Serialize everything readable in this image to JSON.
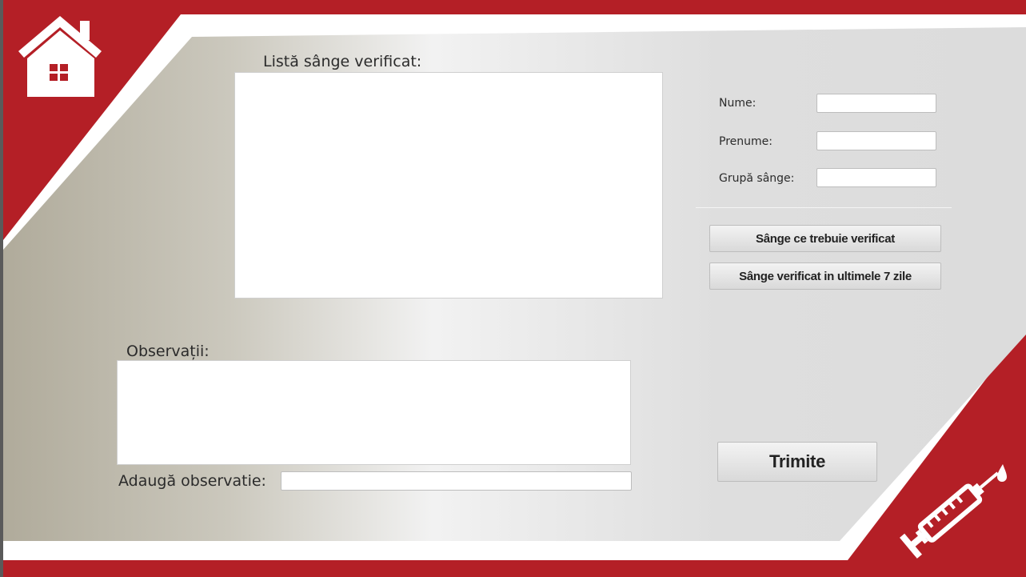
{
  "list_panel": {
    "label": "Listă sânge verificat:"
  },
  "observations": {
    "label": "Observații:"
  },
  "add_observation": {
    "label": "Adaugă observatie:",
    "value": ""
  },
  "form": {
    "nume_label": "Nume:",
    "nume_value": "",
    "prenume_label": "Prenume:",
    "prenume_value": "",
    "grupa_label": "Grupă sânge:",
    "grupa_value": ""
  },
  "buttons": {
    "to_verify": "Sânge ce trebuie verificat",
    "verified_7days": "Sânge verificat in ultimele 7 zile",
    "send": "Trimite"
  },
  "icons": {
    "home": "home-icon",
    "syringe": "syringe-icon"
  },
  "colors": {
    "accent": "#b41f26",
    "panel_dark": "#b0ab9b",
    "panel_light": "#f2f2f2"
  }
}
